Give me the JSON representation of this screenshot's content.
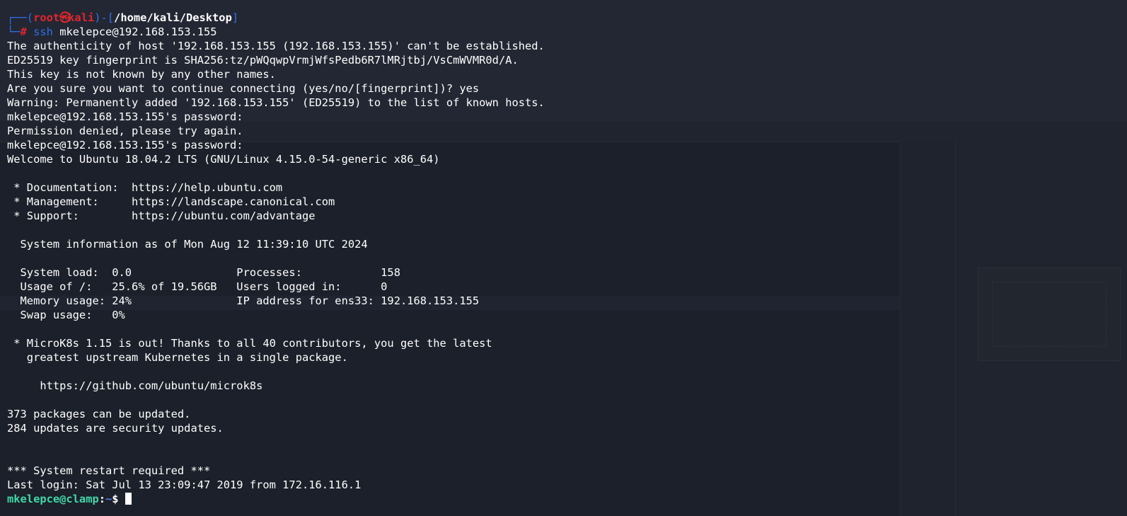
{
  "kali_prompt": {
    "frame_top_left": "┌──(",
    "user": "root",
    "at_glyph": "㉿",
    "host": "kali",
    "frame_mid": ")-[",
    "path": "/home/kali/Desktop",
    "frame_close": "]",
    "frame_bottom_left": "└─",
    "hash": "#",
    "command": "ssh",
    "command_args": " mkelepce@192.168.153.155"
  },
  "output_lines": [
    "The authenticity of host '192.168.153.155 (192.168.153.155)' can't be established.",
    "ED25519 key fingerprint is SHA256:tz/pWQqwpVrmjWfsPedb6R7lMRjtbj/VsCmWVMR0d/A.",
    "This key is not known by any other names.",
    "Are you sure you want to continue connecting (yes/no/[fingerprint])? yes",
    "Warning: Permanently added '192.168.153.155' (ED25519) to the list of known hosts.",
    "mkelepce@192.168.153.155's password: ",
    "Permission denied, please try again.",
    "mkelepce@192.168.153.155's password: ",
    "Welcome to Ubuntu 18.04.2 LTS (GNU/Linux 4.15.0-54-generic x86_64)",
    "",
    " * Documentation:  https://help.ubuntu.com",
    " * Management:     https://landscape.canonical.com",
    " * Support:        https://ubuntu.com/advantage",
    "",
    "  System information as of Mon Aug 12 11:39:10 UTC 2024",
    "",
    "  System load:  0.0                Processes:            158",
    "  Usage of /:   25.6% of 19.56GB   Users logged in:      0",
    "  Memory usage: 24%                IP address for ens33: 192.168.153.155",
    "  Swap usage:   0%",
    "",
    " * MicroK8s 1.15 is out! Thanks to all 40 contributors, you get the latest",
    "   greatest upstream Kubernetes in a single package.",
    "",
    "     https://github.com/ubuntu/microk8s",
    "",
    "373 packages can be updated.",
    "284 updates are security updates.",
    "",
    "",
    "*** System restart required ***",
    "Last login: Sat Jul 13 23:09:47 2019 from 172.16.116.1"
  ],
  "remote_prompt": {
    "user_host": "mkelepce@clamp",
    "sep": ":",
    "path": "~",
    "dollar": "$ "
  },
  "colors": {
    "background": "#1c202a",
    "text": "#ffffff",
    "kali_frame": "#2f6fe4",
    "kali_user": "#e0262c",
    "remote_prompt": "#3fd8a8"
  }
}
